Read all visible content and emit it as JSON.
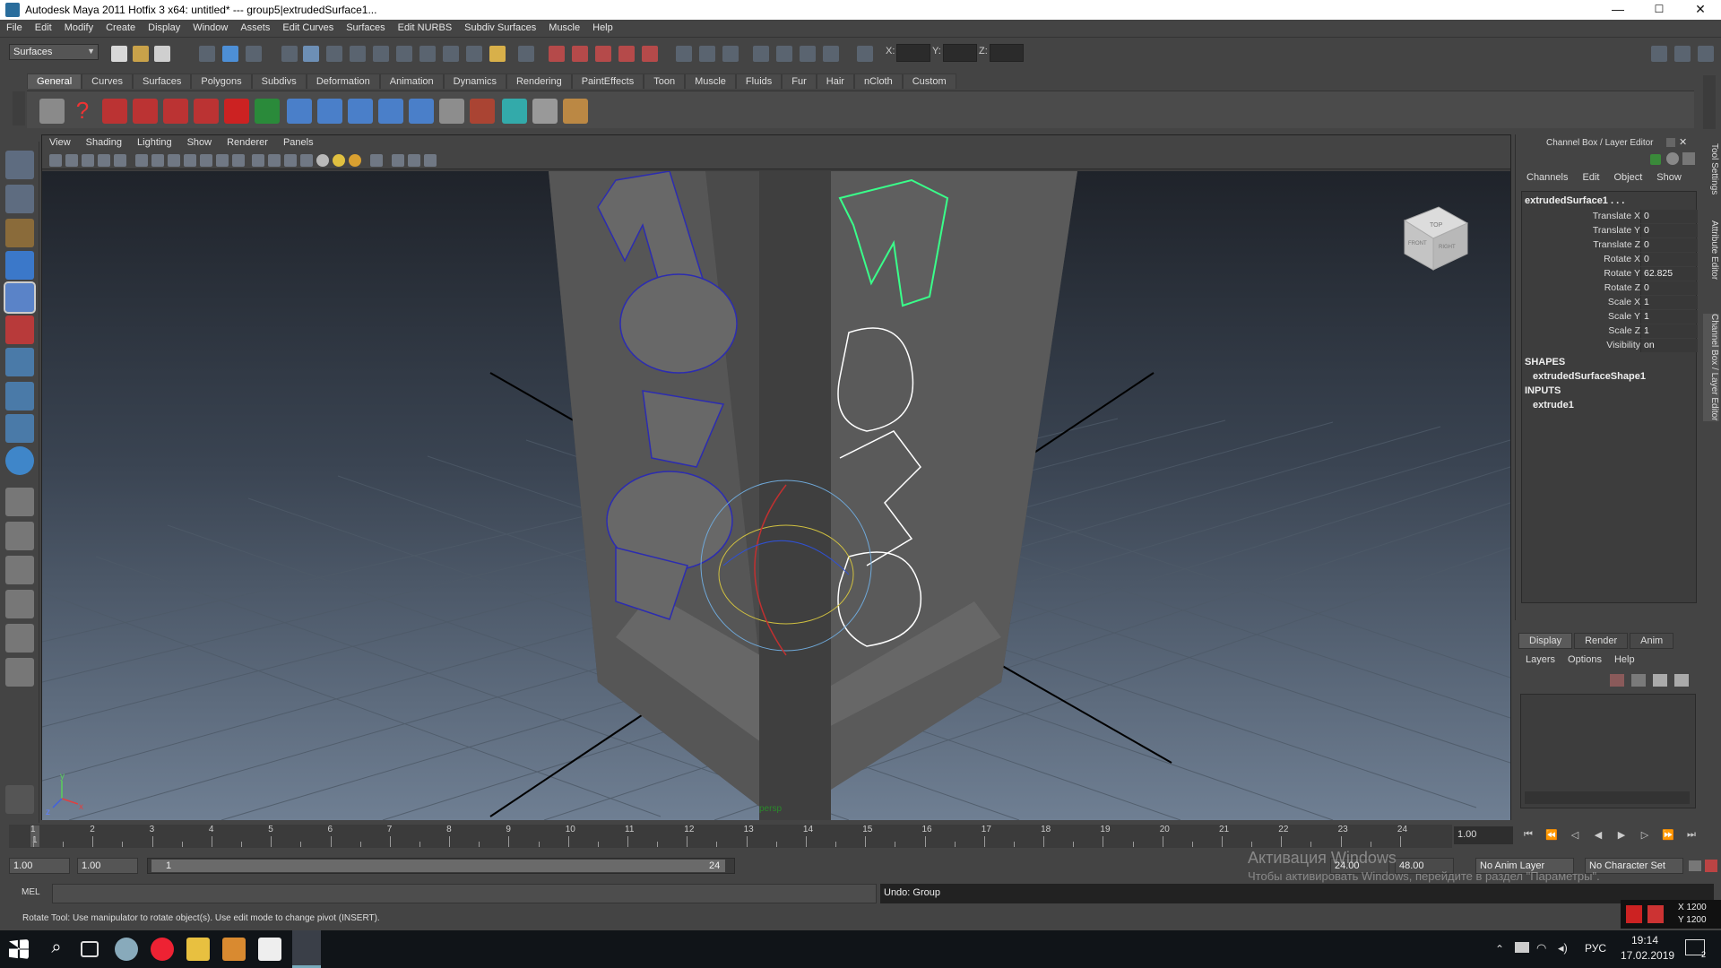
{
  "window": {
    "title": "Autodesk Maya 2011 Hotfix 3 x64: untitled*   ---   group5|extrudedSurface1...",
    "min": "—",
    "max": "☐",
    "close": "✕"
  },
  "menu": [
    "File",
    "Edit",
    "Modify",
    "Create",
    "Display",
    "Window",
    "Assets",
    "Edit Curves",
    "Surfaces",
    "Edit NURBS",
    "Subdiv Surfaces",
    "Muscle",
    "Help"
  ],
  "status_line": {
    "menuset": "Surfaces",
    "x_label": "X:",
    "y_label": "Y:",
    "z_label": "Z:"
  },
  "shelf_tabs": [
    "General",
    "Curves",
    "Surfaces",
    "Polygons",
    "Subdivs",
    "Deformation",
    "Animation",
    "Dynamics",
    "Rendering",
    "PaintEffects",
    "Toon",
    "Muscle",
    "Fluids",
    "Fur",
    "Hair",
    "nCloth",
    "Custom"
  ],
  "shelf_active": "General",
  "panel_menu": [
    "View",
    "Shading",
    "Lighting",
    "Show",
    "Renderer",
    "Panels"
  ],
  "viewport": {
    "camera_label": "persp",
    "viewcube_top": "TOP",
    "viewcube_front": "FRONT",
    "viewcube_right": "RIGHT",
    "axis_y": "y",
    "axis_x": "x",
    "axis_z": "z"
  },
  "channel_box": {
    "title": "Channel Box / Layer Editor",
    "menu": [
      "Channels",
      "Edit",
      "Object",
      "Show"
    ],
    "object": "extrudedSurface1 . . .",
    "attributes": [
      {
        "name": "Translate X",
        "value": "0"
      },
      {
        "name": "Translate Y",
        "value": "0"
      },
      {
        "name": "Translate Z",
        "value": "0"
      },
      {
        "name": "Rotate X",
        "value": "0"
      },
      {
        "name": "Rotate Y",
        "value": "62.825"
      },
      {
        "name": "Rotate Z",
        "value": "0"
      },
      {
        "name": "Scale X",
        "value": "1"
      },
      {
        "name": "Scale Y",
        "value": "1"
      },
      {
        "name": "Scale Z",
        "value": "1"
      },
      {
        "name": "Visibility",
        "value": "on"
      }
    ],
    "shapes_label": "SHAPES",
    "shape": "extrudedSurfaceShape1",
    "inputs_label": "INPUTS",
    "input": "extrude1"
  },
  "side_tabs": [
    "Tool Settings",
    "Attribute Editor",
    "Channel Box / Layer Editor"
  ],
  "layer_editor": {
    "tabs": [
      "Display",
      "Render",
      "Anim"
    ],
    "menu": [
      "Layers",
      "Options",
      "Help"
    ]
  },
  "timeline": {
    "ticks": [
      "1",
      "2",
      "3",
      "4",
      "5",
      "6",
      "7",
      "8",
      "9",
      "10",
      "11",
      "12",
      "13",
      "14",
      "15",
      "16",
      "17",
      "18",
      "19",
      "20",
      "21",
      "22",
      "23",
      "24"
    ],
    "current_frame": "1.00",
    "marker": "1"
  },
  "range": {
    "start_time": "1.00",
    "playback_start": "1.00",
    "slider_start": "1",
    "slider_end": "24",
    "playback_end": "24.00",
    "end_time": "48.00",
    "anim_layer": "No Anim Layer",
    "char_set": "No Character Set"
  },
  "command": {
    "mel_label": "MEL",
    "output": "Undo: Group"
  },
  "help_line": "Rotate Tool: Use manipulator to rotate object(s). Use edit mode to change pivot (INSERT).",
  "coords": {
    "x": "X 1200",
    "y": "Y 1200"
  },
  "windows_activation": {
    "line1": "Активация Windows",
    "line2": "Чтобы активировать Windows, перейдите в раздел \"Параметры\"."
  },
  "taskbar": {
    "lang": "РУС",
    "time": "19:14",
    "date": "17.02.2019",
    "notif_count": "2"
  },
  "colors": {
    "selection_green": "#39ff8a",
    "wire_blue": "#3a3aff",
    "viewport_top": "#1f232a",
    "viewport_bottom": "#6f7f93"
  }
}
